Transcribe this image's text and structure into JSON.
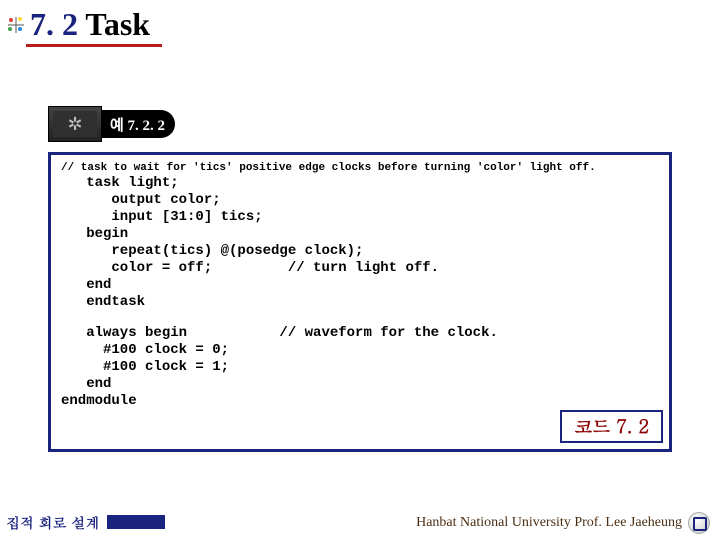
{
  "title": {
    "number": "7. 2",
    "word": " Task"
  },
  "example_tag": "예 7. 2. 2",
  "code": {
    "comment": "// task to wait for 'tics' positive edge clocks before turning 'color' light off.",
    "block1": "   task light;\n      output color;\n      input [31:0] tics;\n   begin\n      repeat(tics) @(posedge clock);\n      color = off;         // turn light off.\n   end\n   endtask",
    "block2": "   always begin           // waveform for the clock.\n     #100 clock = 0;\n     #100 clock = 1;\n   end\nendmodule",
    "label": "코드 7. 2"
  },
  "footer": {
    "left": "집적 회로 설계",
    "right": "Hanbat National University Prof. Lee Jaeheung"
  }
}
